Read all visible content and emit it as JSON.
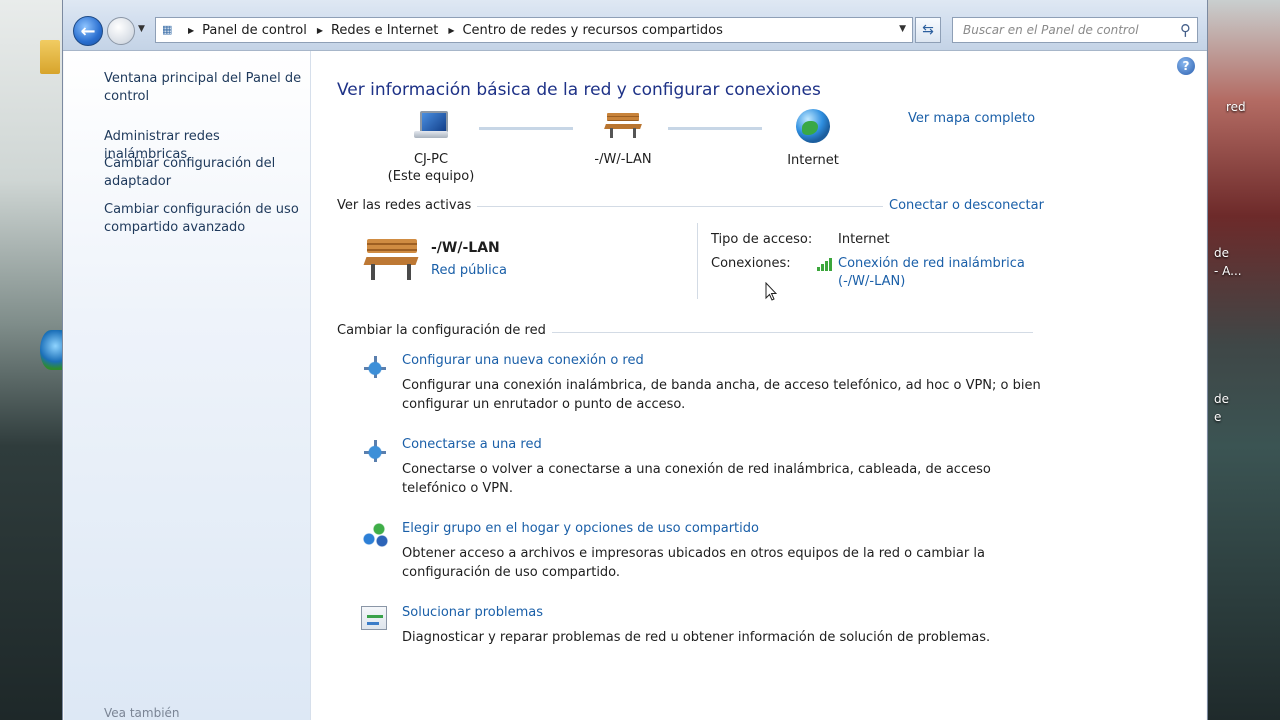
{
  "desktop": {
    "right_snippets": [
      "red",
      "de",
      "- A...",
      "de",
      "e"
    ]
  },
  "addressbar": {
    "crumbs": [
      "Panel de control",
      "Redes e Internet",
      "Centro de redes y recursos compartidos"
    ]
  },
  "search": {
    "placeholder": "Buscar en el Panel de control"
  },
  "sidebar": {
    "items": [
      {
        "label": "Ventana principal del Panel de control"
      },
      {
        "label": "Administrar redes inalámbricas"
      },
      {
        "label": "Cambiar configuración del adaptador"
      },
      {
        "label": "Cambiar configuración de uso compartido avanzado"
      }
    ],
    "see_also": "Vea también"
  },
  "main": {
    "title": "Ver información básica de la red y configurar conexiones",
    "map_link": "Ver mapa completo",
    "map": {
      "computer_name": "CJ-PC",
      "computer_sub": "(Este equipo)",
      "network_name": "-/W/-LAN",
      "internet_label": "Internet"
    },
    "active": {
      "header": "Ver las redes activas",
      "connect_link": "Conectar o desconectar",
      "network_name": "-/W/-LAN",
      "network_type": "Red pública",
      "access_key": "Tipo de acceso:",
      "access_value": "Internet",
      "connections_key": "Conexiones:",
      "connection_link": "Conexión de red inalámbrica (-/W/-LAN)"
    },
    "change": {
      "header": "Cambiar la configuración de red",
      "tasks": [
        {
          "title": "Configurar una nueva conexión o red",
          "desc": "Configurar una conexión inalámbrica, de banda ancha, de acceso telefónico, ad hoc o VPN; o bien configurar un enrutador o punto de acceso."
        },
        {
          "title": "Conectarse a una red",
          "desc": "Conectarse o volver a conectarse a una conexión de red inalámbrica, cableada, de acceso telefónico o VPN."
        },
        {
          "title": "Elegir grupo en el hogar y opciones de uso compartido",
          "desc": "Obtener acceso a archivos e impresoras ubicados en otros equipos de la red o cambiar la configuración de uso compartido."
        },
        {
          "title": "Solucionar problemas",
          "desc": "Diagnosticar y reparar problemas de red u obtener información de solución de problemas."
        }
      ]
    }
  }
}
